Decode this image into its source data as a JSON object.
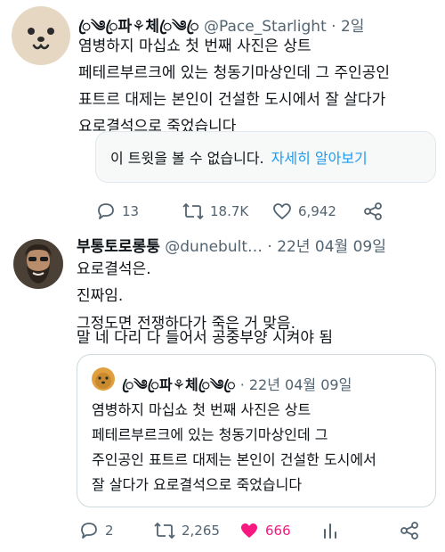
{
  "tweet1": {
    "display_name": "ꦿ༄ꦿ파⚘체ꦿ༄ꦿ",
    "handle": "@Pace_Starlight",
    "time": "2일",
    "lines": [
      "염병하지 마십쇼 첫 번째 사진은 상트",
      "페테르부르크에 있는 청동기마상인데 그 주인공인",
      "표트르 대제는 본인이 건설한 도시에서 잘 살다가",
      "요로결석으로 죽었습니다"
    ],
    "unavailable_text": "이 트윗을 볼 수 없습니다.",
    "unavailable_link": "자세히 알아보기",
    "replies": "13",
    "retweets": "18.7K",
    "likes": "6,942"
  },
  "tweet2": {
    "display_name": "부통토로롱퉁",
    "handle": "@dunebult…",
    "time": "22년 04월 09일",
    "lines": [
      "요로결석은.",
      "진짜임.",
      "그정도면 전쟁하다가 죽은 거 맞음.",
      "말 네 다리 다 들어서 공중부양 시켜야 됨"
    ],
    "quote": {
      "display_name": "ꦿ༄ꦿ파⚘체ꦿ༄ꦿ",
      "time": "22년 04월 09일",
      "lines": [
        "염병하지 마십쇼 첫 번째 사진은 상트",
        "페테르부르크에 있는 청동기마상인데 그",
        "주인공인 표트르 대제는 본인이 건설한 도시에서",
        "잘 살다가 요로결석으로 죽었습니다"
      ]
    },
    "replies": "2",
    "retweets": "2,265",
    "likes": "666"
  },
  "colors": {
    "like_active": "#f91880",
    "link": "#1d9bf0",
    "muted": "#536471"
  }
}
